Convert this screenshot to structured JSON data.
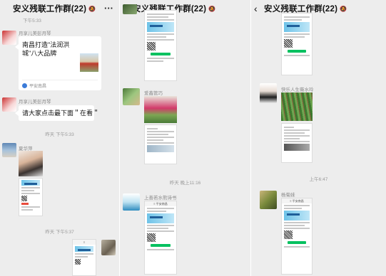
{
  "panel1": {
    "title": "安义残联工作群(22)",
    "bell_icon": "bell-off-icon",
    "more_icon": "more-icon",
    "top_time": "下午5:33",
    "msg1_sender": "月享儿美彭月琴",
    "card_text": "南昌打造\"法润洪城\"八大品牌",
    "card_source": "平安南昌",
    "msg2_sender": "月享儿美彭月琴",
    "msg2_text": "请大家点击最下面＂在看＂",
    "time1": "昨天 下午5:33",
    "msg3_sender": "夏华萍",
    "time2": "昨天 下午5:37"
  },
  "panel2": {
    "title": "安义残联工作群(22)",
    "msg1_sender": "爱鑫管巧",
    "time1": "昨天 晚上11:16",
    "msg2_sender": "上善若水熊诗书"
  },
  "panel3": {
    "title": "安义残联工作群(22)",
    "msg1_sender": "快乐人生薇水玲",
    "time1": "上午6:47",
    "msg2_sender": "杨菊妹"
  },
  "colors": {
    "chat_bg": "#ededed",
    "bubble": "#ffffff",
    "wechat_green": "#07c160",
    "banner_blue": "#6ec3e8"
  }
}
